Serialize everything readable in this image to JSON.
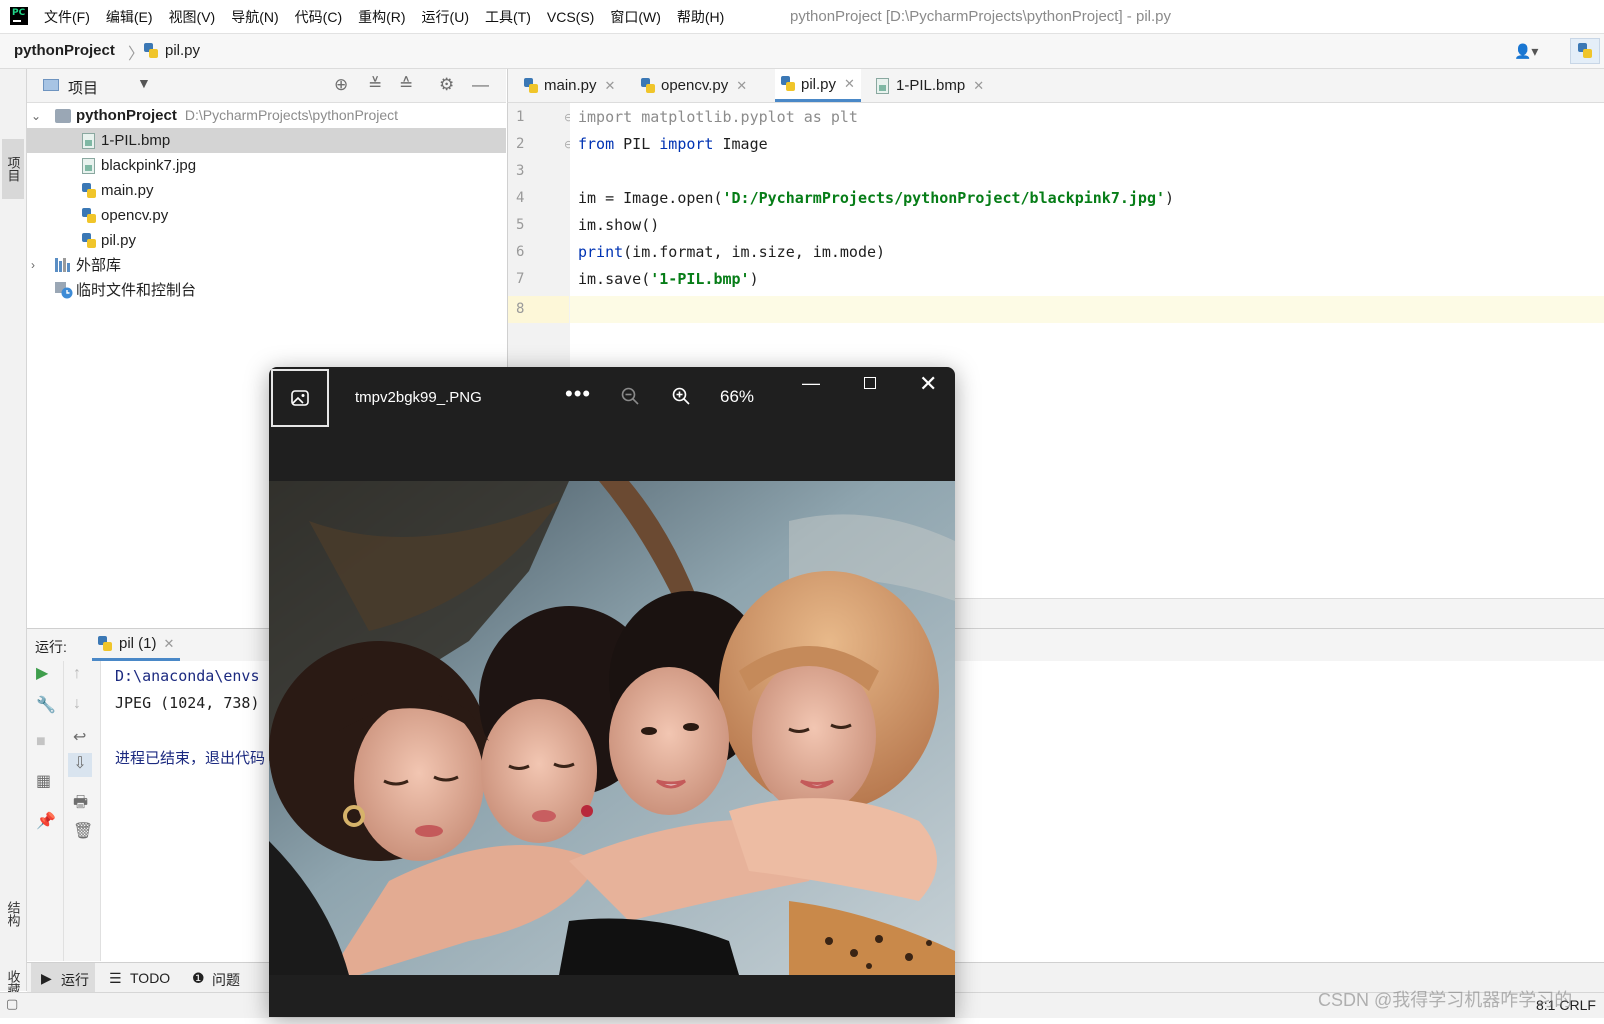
{
  "menubar": {
    "items": [
      "文件(F)",
      "编辑(E)",
      "视图(V)",
      "导航(N)",
      "代码(C)",
      "重构(R)",
      "运行(U)",
      "工具(T)",
      "VCS(S)",
      "窗口(W)",
      "帮助(H)"
    ],
    "window_title": "pythonProject [D:\\PycharmProjects\\pythonProject] - pil.py"
  },
  "navbar": {
    "project": "pythonProject",
    "separator": "〉",
    "file": "pil.py"
  },
  "left_stripe": {
    "project": "项目",
    "structure": "结构",
    "favorites": "收藏夹"
  },
  "project_panel": {
    "title": "项目",
    "root_name": "pythonProject",
    "root_path": "D:\\PycharmProjects\\pythonProject",
    "files": [
      "1-PIL.bmp",
      "blackpink7.jpg",
      "main.py",
      "opencv.py",
      "pil.py"
    ],
    "external_libs": "外部库",
    "scratches": "临时文件和控制台"
  },
  "editor": {
    "tabs": [
      "main.py",
      "opencv.py",
      "pil.py",
      "1-PIL.bmp"
    ],
    "active_tab": "pil.py",
    "line_numbers": [
      "1",
      "2",
      "3",
      "4",
      "5",
      "6",
      "7",
      "8"
    ],
    "code": {
      "l1_kw": "import",
      "l1_rest": " matplotlib.pyplot ",
      "l1_as": "as",
      "l1_alias": " plt",
      "l2_from": "from",
      "l2_mod": " PIL ",
      "l2_import": "import",
      "l2_name": " Image",
      "l4_pre": "im = Image.open(",
      "l4_str": "'D:/PycharmProjects/pythonProject/blackpink7.jpg'",
      "l4_post": ")",
      "l5": "im.show()",
      "l6_fn": "print",
      "l6_rest": "(im.format, im.size, im.mode)",
      "l7_pre": "im.save(",
      "l7_str": "'1-PIL.bmp'",
      "l7_post": ")"
    }
  },
  "run_panel": {
    "label": "运行:",
    "tab": "pil (1)",
    "console": [
      "D:\\anaconda\\envs",
      "JPEG (1024, 738)",
      "进程已结束，退出代码"
    ]
  },
  "bottom_bar": {
    "run": "运行",
    "todo": "TODO",
    "problems": "问题"
  },
  "status_bar": {
    "position": "8:1  CRLF",
    "watermark": "CSDN @我得学习机器咋学习的"
  },
  "viewer": {
    "title": "tmpv2bgk99_.PNG",
    "more": "•••",
    "zoom": "66%"
  }
}
